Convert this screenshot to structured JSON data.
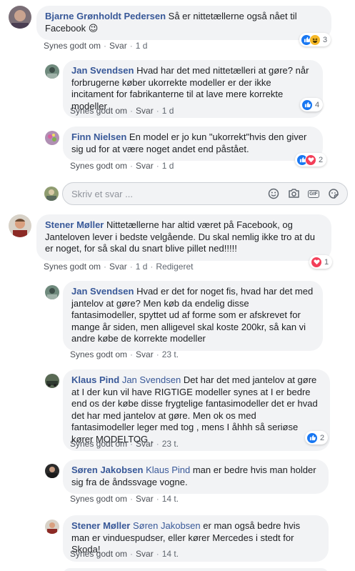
{
  "actions": {
    "like": "Synes godt om",
    "reply": "Svar",
    "edited": "Redigeret"
  },
  "reply_box": {
    "placeholder": "Skriv et svar ..."
  },
  "comments": [
    {
      "author": "Bjarne Grønholdt Pedersen",
      "text": "Så er nittetællerne også nået til Facebook",
      "emoji": "😉",
      "time": "1 d",
      "reactions": [
        "like",
        "haha"
      ],
      "count": "3"
    },
    {
      "author": "Jan Svendsen",
      "text": "Hvad har det med nittetælleri at gøre? når forbrugerne køber ukorrekte modeller er der ikke incitament for fabrikanterne til at lave mere korrekte modeller",
      "time": "1 d",
      "reactions": [
        "like"
      ],
      "count": "4"
    },
    {
      "author": "Finn Nielsen",
      "text": "En model er jo kun \"ukorrekt\"hvis den giver sig ud for at være noget andet end påstået.",
      "time": "1 d",
      "reactions": [
        "like",
        "love"
      ],
      "count": "2"
    },
    {
      "author": "Stener Møller",
      "text": "Nittetællerne har altid været på Facebook, og Janteloven lever i bedste velgående. Du skal nemlig ikke tro at du er noget, for så skal du snart blive pillet ned!!!!!",
      "time": "1 d",
      "reactions": [
        "love"
      ],
      "count": "1"
    },
    {
      "author": "Jan Svendsen",
      "text": "Hvad er det for noget fis, hvad har det med jantelov at gøre? Men køb da endelig disse fantasimodeller, spyttet ud af forme som er afskrevet for mange år siden, men alligevel skal koste 200kr, så kan vi andre købe de korrekte modeller",
      "time": "23 t."
    },
    {
      "author": "Klaus Pind",
      "mention": "Jan Svendsen",
      "text": "Det har det med jantelov at gøre at I der kun vil have RIGTIGE modeller synes at I er bedre end os der købe disse frygtelige fantasimodeller det er hvad det har med jantelov at gøre. Men ok os med fantasimodeller leger med tog , mens I åhhh så seriøse kører MODELTOG .",
      "time": "23 t.",
      "reactions": [
        "like"
      ],
      "count": "2"
    },
    {
      "author": "Søren Jakobsen",
      "mention": "Klaus Pind",
      "text": "man er bedre hvis man holder sig fra de åndssvage vogne.",
      "time": "14 t."
    },
    {
      "author": "Stener Møller",
      "mention": "Søren Jakobsen",
      "text": "er man også bedre hvis man er vinduespudser, eller kører Mercedes i stedt for Skoda!",
      "time": "14 t."
    }
  ]
}
